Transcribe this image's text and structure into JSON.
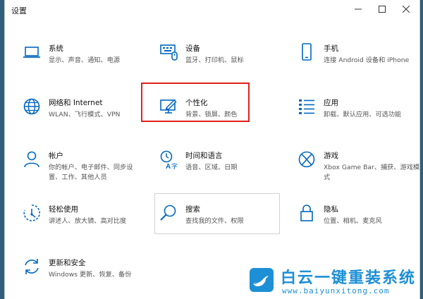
{
  "window": {
    "title": "设置"
  },
  "tiles": [
    {
      "name": "系统",
      "desc": "显示、声音、通知、电源",
      "icon": "laptop-icon"
    },
    {
      "name": "设备",
      "desc": "蓝牙、打印机、鼠标",
      "icon": "devices-icon"
    },
    {
      "name": "手机",
      "desc": "连接 Android 设备和 iPhone",
      "icon": "phone-icon"
    },
    {
      "name": "网络和 Internet",
      "desc": "WLAN、飞行模式、VPN",
      "icon": "globe-icon"
    },
    {
      "name": "个性化",
      "desc": "背景、锁屏、颜色",
      "icon": "personalization-icon"
    },
    {
      "name": "应用",
      "desc": "卸载、默认应用、可选功能",
      "icon": "apps-icon"
    },
    {
      "name": "帐户",
      "desc": "你的帐户、电子邮件、同步设置、工作、其他人员",
      "icon": "user-icon"
    },
    {
      "name": "时间和语言",
      "desc": "语音、区域、日期",
      "icon": "time-language-icon"
    },
    {
      "name": "游戏",
      "desc": "Xbox Game Bar、捕获、游戏模式",
      "icon": "xbox-icon"
    },
    {
      "name": "轻松使用",
      "desc": "讲述人、放大镜、高对比度",
      "icon": "ease-of-access-icon"
    },
    {
      "name": "搜索",
      "desc": "查找我的文件、权限",
      "icon": "search-icon"
    },
    {
      "name": "隐私",
      "desc": "位置、相机、麦克风",
      "icon": "lock-icon"
    },
    {
      "name": "更新和安全",
      "desc": "Windows 更新、恢复、备份",
      "icon": "sync-icon"
    }
  ],
  "watermark": {
    "title": "白云一键重装系统",
    "url": "www.baiyunxitong.com"
  },
  "colors": {
    "accent": "#0067c0",
    "highlight": "#e0201a",
    "watermark": "#1d8fd6"
  }
}
